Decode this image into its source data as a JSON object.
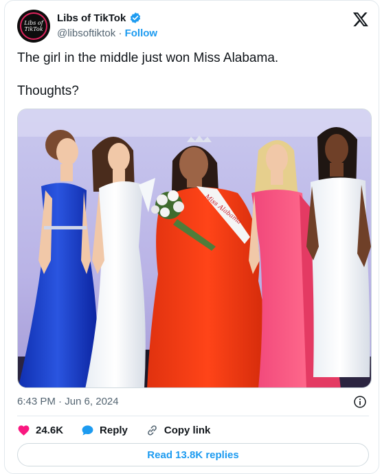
{
  "author": {
    "name": "Libs of TikTok",
    "handle": "@libsoftiktok",
    "separator": "·",
    "follow_label": "Follow",
    "avatar_text_line1": "Libs of",
    "avatar_text_line2": "TikTok",
    "verified": true
  },
  "tweet": {
    "text": "The girl in the middle just won Miss Alabama.\n\nThoughts?",
    "media": {
      "sash_text": "Miss Alabama"
    },
    "timestamp": "6:43 PM · Jun 6, 2024"
  },
  "actions": {
    "like_count": "24.6K",
    "reply_label": "Reply",
    "copy_link_label": "Copy link"
  },
  "footer": {
    "read_replies_label": "Read 13.8K replies"
  },
  "colors": {
    "accent": "#1d9bf0",
    "like": "#f91880",
    "text_secondary": "#536471"
  },
  "icons": [
    "verified-badge-icon",
    "x-logo-icon",
    "info-icon",
    "heart-icon",
    "reply-bubble-icon",
    "link-icon"
  ]
}
